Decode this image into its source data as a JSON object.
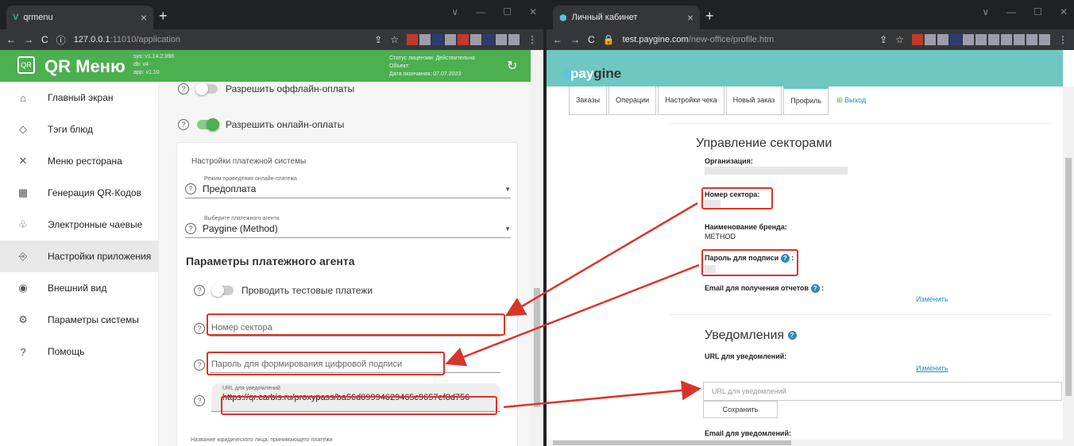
{
  "left": {
    "tab_title": "qrmenu",
    "url_host": "127.0.0.1",
    "url_rest": ":11010/application",
    "app": {
      "name": "QR Меню",
      "logo_text": "QR",
      "versions": [
        "sys: v1.14.2.998",
        "db: v4",
        "app: v1.10"
      ],
      "license": [
        "Статус лицензии: Действительна",
        "Объект:",
        "Дата окончания: 07.07.2023"
      ]
    },
    "sidebar": [
      {
        "label": "Главный экран",
        "icon": "⌂"
      },
      {
        "label": "Тэги блюд",
        "icon": "◇"
      },
      {
        "label": "Меню ресторана",
        "icon": "✕"
      },
      {
        "label": "Генерация QR-Кодов",
        "icon": "▦"
      },
      {
        "label": "Электронные чаевые",
        "icon": "♧"
      },
      {
        "label": "Настройки приложения",
        "icon": "⎆"
      },
      {
        "label": "Внешний вид",
        "icon": "◉"
      },
      {
        "label": "Параметры системы",
        "icon": "⚙"
      },
      {
        "label": "Помощь",
        "icon": "?"
      }
    ],
    "offline_label": "Разрешить оффлайн-оплаты",
    "online_label": "Разрешить онлайн-оплаты",
    "card_title": "Настройки платежной системы",
    "mode_label": "Режим проведения онлайн-платежа",
    "mode_value": "Предоплата",
    "agent_label": "Выберите платежного агента",
    "agent_value": "Paygine (Method)",
    "params_title": "Параметры платежного агента",
    "test_label": "Проводить тестовые платежи",
    "sector_placeholder": "Номер сектора",
    "password_placeholder": "Пароль для формирования цифровой подписи",
    "url_label": "URL для уведомлений",
    "url_value": "https://qr.carbis.ru/proxypass/ba56d09994629465c9657ef8d756",
    "footer_label": "Название юридического лица, принимающего платежи"
  },
  "right": {
    "tab_title": "Личный кабинет",
    "url_host": "test.paygine.com",
    "url_rest": "/new-office/profile.htm",
    "brand_a": "pay",
    "brand_b": "gine",
    "tabs": [
      "Заказы",
      "Операции",
      "Настройки чека",
      "Новый заказ",
      "Профиль",
      "Выход"
    ],
    "sectors_title": "Управление секторами",
    "org_label": "Организация:",
    "sector_label": "Номер сектора:",
    "brand_label": "Наименование бренда:",
    "brand_value": "METHOD",
    "sign_label": "Пароль для подписи",
    "email_reports_label": "Email для получения отчетов",
    "change": "Изменить",
    "notif_title": "Уведомления",
    "notif_url_label": "URL для уведомлений:",
    "notif_input_placeholder": "URL для уведомлений",
    "save": "Сохранить",
    "notif_email_label": "Email для уведомлений:"
  },
  "colors": {
    "green": "#4caf50",
    "teal": "#6ec7c1",
    "red": "#d9342b",
    "link": "#2b8ab6"
  }
}
